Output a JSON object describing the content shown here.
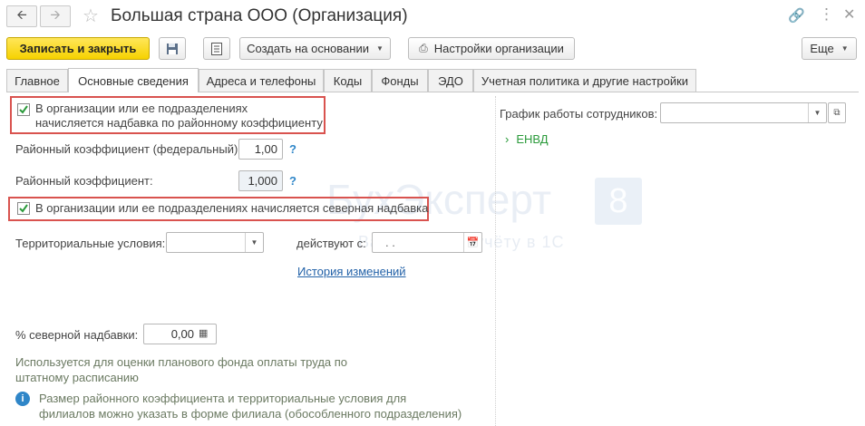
{
  "window": {
    "title": "Большая страна ООО (Организация)"
  },
  "toolbar": {
    "save_close": "Записать и закрыть",
    "create_based": "Создать на основании",
    "org_settings": "Настройки организации",
    "more": "Еще"
  },
  "tabs": [
    {
      "label": "Главное"
    },
    {
      "label": "Основные сведения"
    },
    {
      "label": "Адреса и телефоны"
    },
    {
      "label": "Коды"
    },
    {
      "label": "Фонды"
    },
    {
      "label": "ЭДО"
    },
    {
      "label": "Учетная политика и другие настройки"
    }
  ],
  "form": {
    "regional_checkbox": {
      "checked": true,
      "line1": "В организации или ее подразделениях",
      "line2": "начисляется надбавка по районному коэффициенту"
    },
    "federal_coef": {
      "label": "Районный коэффициент (федеральный):",
      "value": "1,00",
      "help": "?"
    },
    "regional_coef": {
      "label": "Районный коэффициент:",
      "value": "1,000",
      "help": "?"
    },
    "northern_checkbox": {
      "checked": true,
      "label": "В организации или ее подразделениях начисляется северная надбавка"
    },
    "territorial": {
      "label": "Территориальные условия:",
      "value": ""
    },
    "valid_from": {
      "label": "действуют с:",
      "value": ". ."
    },
    "history_link": "История изменений",
    "northern_percent": {
      "label": "% северной надбавки:",
      "value": "0,00"
    },
    "hint": "Используется для оценки планового фонда оплаты труда по штатному расписанию",
    "info": "Размер районного коэффициента и территориальные условия для филиалов можно указать в форме филиала (обособленного подразделения)"
  },
  "right": {
    "schedule_label": "График работы сотрудников:",
    "schedule_value": "",
    "envd": "ЕНВД"
  },
  "watermark": {
    "brand": "БухЭксперт",
    "digit": "8",
    "tagline": "Ваш ответ по учёту в 1С"
  }
}
